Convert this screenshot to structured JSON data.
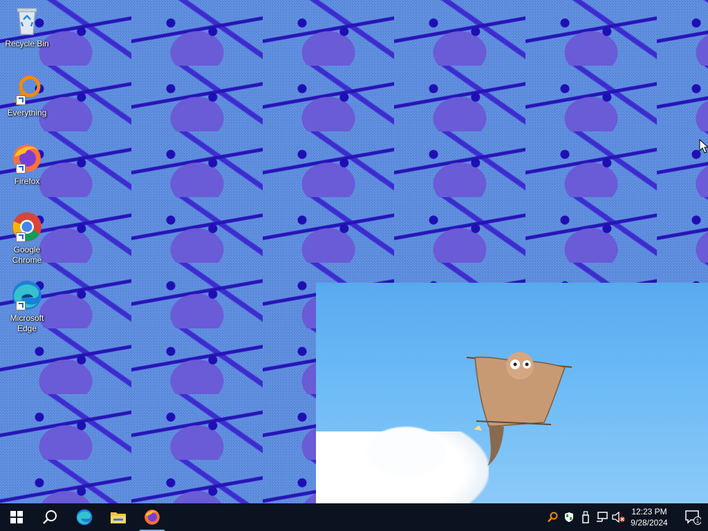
{
  "desktop": {
    "icons": [
      {
        "label": "Recycle Bin",
        "icon": "recycle-bin-icon"
      },
      {
        "label": "Everything",
        "icon": "everything-search-icon"
      },
      {
        "label": "Firefox",
        "icon": "firefox-icon"
      },
      {
        "label": "Google Chrome",
        "icon": "chrome-icon"
      },
      {
        "label": "Microsoft Edge",
        "icon": "edge-icon"
      }
    ]
  },
  "taskbar": {
    "pinned": [
      {
        "name": "start",
        "icon": "windows-logo-icon"
      },
      {
        "name": "search",
        "icon": "search-icon"
      },
      {
        "name": "edge",
        "icon": "edge-icon"
      },
      {
        "name": "file-explorer",
        "icon": "folder-icon"
      },
      {
        "name": "firefox",
        "icon": "firefox-icon",
        "active": true
      }
    ],
    "tray": [
      {
        "icon": "everything-search-icon"
      },
      {
        "icon": "shield-icon"
      },
      {
        "icon": "usb-drive-icon"
      },
      {
        "icon": "network-icon"
      },
      {
        "icon": "volume-muted-icon"
      }
    ],
    "clock": {
      "time": "12:23 PM",
      "date": "9/28/2024"
    },
    "notifications": {
      "count": "1"
    }
  },
  "colors": {
    "taskbar": "#0b1320",
    "wallpaper_base": "#5f8fe6",
    "sky": "#6cbaf6"
  }
}
